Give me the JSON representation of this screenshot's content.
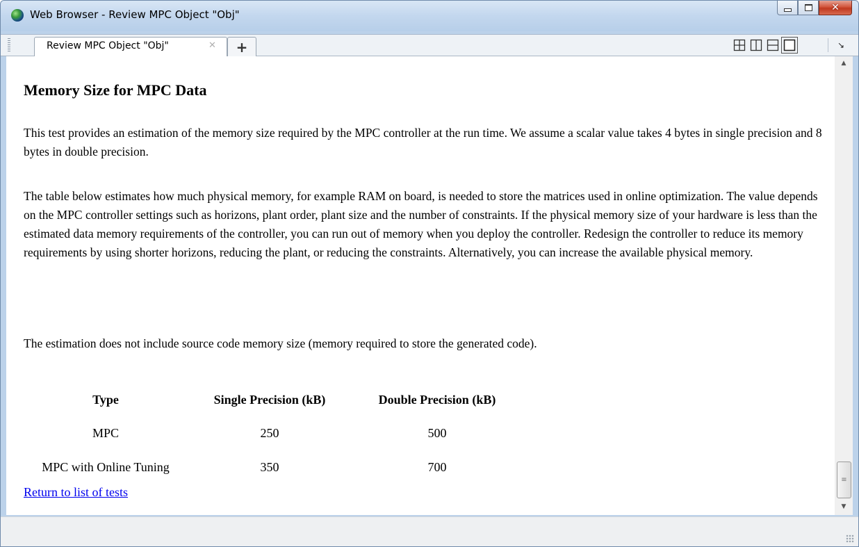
{
  "window": {
    "title": "Web Browser - Review MPC Object \"Obj\"",
    "icon": "globe-icon",
    "controls": {
      "minimize": "minimize-icon",
      "maximize": "maximize-icon",
      "close": "✕"
    }
  },
  "tabs": {
    "items": [
      {
        "label": "Review MPC Object \"Obj\"",
        "close_icon": "✕"
      }
    ],
    "new_tab_label": "+",
    "layout_icons": [
      "grid-2x2-icon",
      "split-vertical-icon",
      "split-horizontal-icon",
      "single-pane-icon"
    ],
    "dock_icon": "↘"
  },
  "page": {
    "heading": "Memory Size for MPC Data",
    "paragraphs": [
      "This test provides an estimation of the memory size required by the MPC controller at the run time. We assume a scalar value takes 4 bytes in single precision and 8 bytes in double precision.",
      "The table below estimates how much physical memory, for example RAM on board, is needed to store the matrices used in online optimization. The value depends on the MPC controller settings such as horizons, plant order, plant size and the number of constraints. If the physical memory size of your hardware is less than the estimated data memory requirements of the controller, you can run out of memory when you deploy the controller. Redesign the controller to reduce its memory requirements by using shorter horizons, reducing the plant, or reducing the constraints. Alternatively, you can increase the available physical memory.",
      "The estimation does not include source code memory size (memory required to store the generated code)."
    ],
    "table": {
      "headers": [
        "Type",
        "Single Precision (kB)",
        "Double Precision (kB)"
      ],
      "rows": [
        [
          "MPC",
          "250",
          "500"
        ],
        [
          "MPC with Online Tuning",
          "350",
          "700"
        ]
      ]
    },
    "return_link": "Return to list of tests"
  },
  "scrollbar": {
    "up_icon": "▲",
    "down_icon": "▼",
    "thumb_grip": "≡"
  }
}
